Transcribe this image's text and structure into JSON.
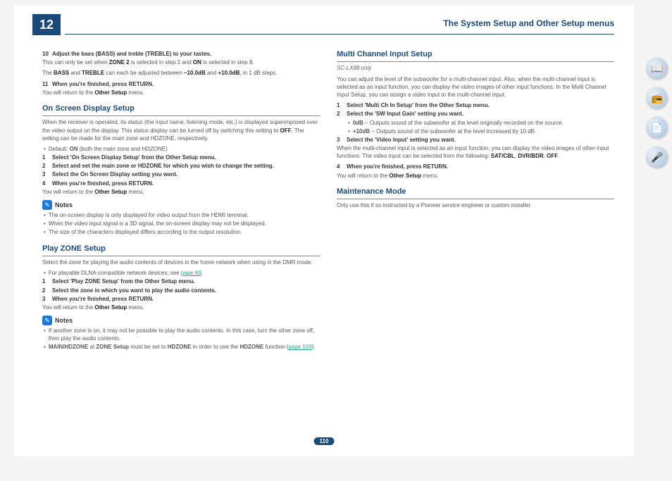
{
  "chapter": "12",
  "header_title": "The System Setup and Other Setup menus",
  "page_number": "110",
  "left": {
    "s10": {
      "num": "10",
      "text": "Adjust the bass (BASS) and treble (TREBLE) to your tastes."
    },
    "s10_note1_a": "This can only be set when ",
    "s10_note1_b": "ZONE 2",
    "s10_note1_c": " is selected in step 2 and ",
    "s10_note1_d": "ON",
    "s10_note1_e": " is selected in step 8.",
    "s10_note2_a": "The ",
    "s10_note2_b": "BASS",
    "s10_note2_c": " and ",
    "s10_note2_d": "TREBLE",
    "s10_note2_e": " can each be adjusted between ",
    "s10_note2_f": "–10.0dB",
    "s10_note2_g": " and ",
    "s10_note2_h": "+10.0dB",
    "s10_note2_i": ", in 1 dB steps.",
    "s11": {
      "num": "11",
      "text": "When you're finished, press RETURN."
    },
    "return_a": "You will return to the ",
    "return_b": "Other Setup",
    "return_c": " menu.",
    "osd_title": "On Screen Display Setup",
    "osd_p1_a": "When the receiver is operated, its status (the input name, listening mode, etc.) is displayed superimposed over the video output on the display. This status display can be turned off by switching this setting to ",
    "osd_p1_b": "OFF",
    "osd_p1_c": ". The setting can be made for the main zone and HDZONE, respectively.",
    "osd_default_a": "Default: ",
    "osd_default_b": "ON",
    "osd_default_c": " (both the main zone and HDZONE)",
    "osd_s1": {
      "num": "1",
      "text": "Select 'On Screen Display Setup' from the Other Setup menu."
    },
    "osd_s2": {
      "num": "2",
      "text": "Select and set the main zone or HDZONE for which you wish to change the setting."
    },
    "osd_s3": {
      "num": "3",
      "text": "Select the On Screen Display setting you want."
    },
    "osd_s4": {
      "num": "4",
      "text": "When you're finished, press RETURN."
    },
    "notes_label": "Notes",
    "osd_n1": "The on-screen display is only displayed for video output from the HDMI terminal.",
    "osd_n2": "When the video input signal is a 3D signal, the on-screen display may not be displayed.",
    "osd_n3": "The size of the characters displayed differs according to the output resolution.",
    "pz_title": "Play ZONE Setup",
    "pz_p1": "Select the zone for playing the audio contents of devices in the home network when using in the DMR mode.",
    "pz_b1_a": "For playable DLNA-compatible network devices, see ",
    "pz_link1": "page 69",
    "pz_s1": {
      "num": "1",
      "text": "Select 'Play ZONE Setup' from the Other Setup menu."
    },
    "pz_s2": {
      "num": "2",
      "text": "Select the zone in which you want to play the audio contents."
    },
    "pz_s3": {
      "num": "3",
      "text": "When you're finished, press RETURN."
    },
    "pz_n1": "If another zone is on, it may not be possible to play the audio contents. In this case, turn the other zone off, then play the audio contents.",
    "pz_n2_a": "MAIN/HDZONE",
    "pz_n2_b": " at ",
    "pz_n2_c": "ZONE Setup",
    "pz_n2_d": " must be set to ",
    "pz_n2_e": "HDZONE",
    "pz_n2_f": " in order to use the ",
    "pz_n2_g": "HDZONE",
    "pz_n2_h": " function (",
    "pz_link2": "page 109",
    "pz_n2_i": ")."
  },
  "right": {
    "mc_title": "Multi Channel Input Setup",
    "mc_model": "SC-LX88 only",
    "mc_p1": "You can adjust the level of the subwoofer for a multi-channel input. Also, when the multi-channel input is selected as an input function, you can display the video images of other input functions. In the Multi Channel Input Setup, you can assign a video input to the multi-channel input.",
    "mc_s1": {
      "num": "1",
      "text": "Select 'Multi Ch In Setup' from the Other Setup menu."
    },
    "mc_s2": {
      "num": "2",
      "text": "Select the 'SW Input Gain' setting you want."
    },
    "mc_b1_a": "0dB",
    "mc_b1_b": " – Outputs sound of the subwoofer at the level originally recorded on the source.",
    "mc_b2_a": "+10dB",
    "mc_b2_b": " – Outputs sound of the subwoofer at the level increased by 10 dB.",
    "mc_s3": {
      "num": "3",
      "text": "Select the 'Video Input' setting you want."
    },
    "mc_p2_a": "When the multi-channel input is selected as an input function, you can display the video images of other input functions. The video input can be selected from the following: ",
    "mc_p2_b": "SAT/CBL",
    "mc_p2_c": ", ",
    "mc_p2_d": "DVR/BDR",
    "mc_p2_e": ", ",
    "mc_p2_f": "OFF",
    "mc_p2_g": ".",
    "mc_s4": {
      "num": "4",
      "text": "When you're finished, press RETURN."
    },
    "mm_title": "Maintenance Mode",
    "mm_p1": "Only use this if so instructed by a Pioneer service engineer or custom installer."
  },
  "icons": {
    "a": "📖",
    "b": "📻",
    "c": "📄",
    "d": "🎤"
  }
}
